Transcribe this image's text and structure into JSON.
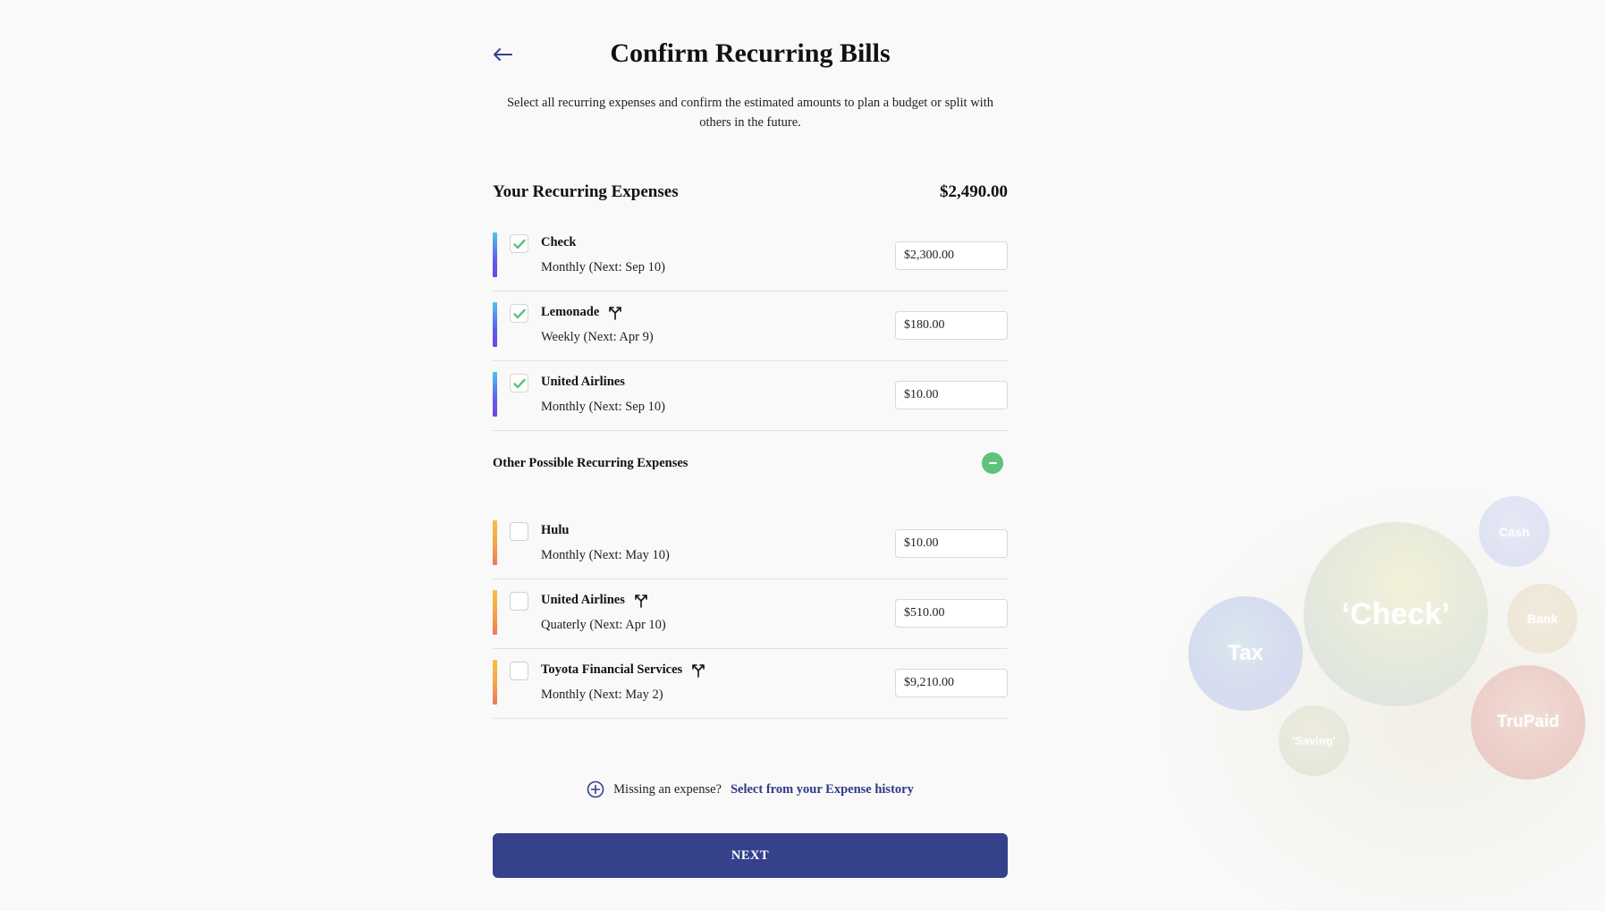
{
  "header": {
    "title": "Confirm Recurring Bills",
    "subtitle": "Select all recurring expenses and confirm the estimated amounts to plan a budget or split with others in the future."
  },
  "recurring": {
    "heading": "Your Recurring Expenses",
    "total": "$2,490.00",
    "items": [
      {
        "name": "Check",
        "freq": "Monthly (Next:  Sep 10)",
        "amount": "$2,300.00",
        "checked": true,
        "split": false
      },
      {
        "name": "Lemonade",
        "freq": "Weekly (Next:  Apr 9)",
        "amount": "$180.00",
        "checked": true,
        "split": true
      },
      {
        "name": "United Airlines",
        "freq": "Monthly (Next:  Sep 10)",
        "amount": "$10.00",
        "checked": true,
        "split": false
      }
    ]
  },
  "other": {
    "heading": "Other Possible Recurring Expenses",
    "items": [
      {
        "name": "Hulu",
        "freq": "Monthly (Next:  May 10)",
        "amount": "$10.00",
        "checked": false,
        "split": false
      },
      {
        "name": "United Airlines",
        "freq": "Quaterly (Next:  Apr 10)",
        "amount": "$510.00",
        "checked": false,
        "split": true
      },
      {
        "name": "Toyota Financial Services",
        "freq": "Monthly (Next:  May 2)",
        "amount": "$9,210.00",
        "checked": false,
        "split": true
      }
    ]
  },
  "missing": {
    "text": "Missing an expense?",
    "link": "Select from your Expense history"
  },
  "next_label": "NEXT",
  "bubbles": {
    "check": "‘Check’",
    "tax": "Tax",
    "cash": "Cash",
    "bank": "Bank",
    "trupaid": "TruPaid",
    "saving": "'Saving'"
  },
  "colors": {
    "primary": "#35418a",
    "check_green": "#5dc27a",
    "link": "#2f3a86"
  },
  "icons": {
    "back": "arrow-left-icon",
    "check": "checkmark-icon",
    "split": "split-arrows-icon",
    "collapse": "minus-circle-icon",
    "add": "plus-circle-icon"
  }
}
